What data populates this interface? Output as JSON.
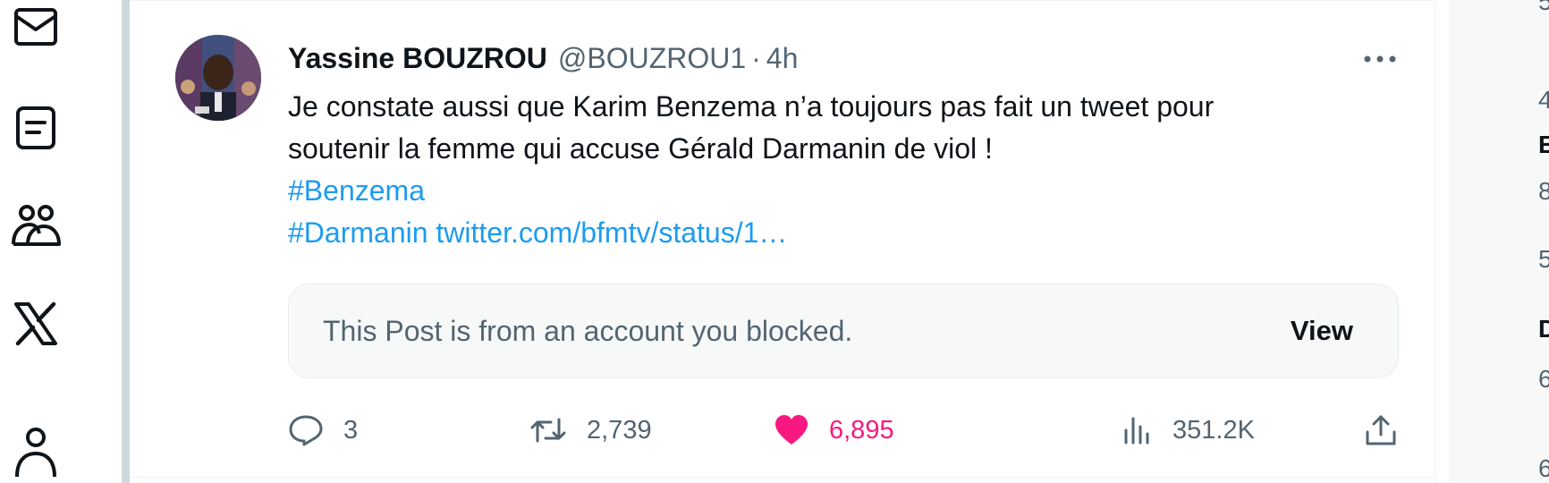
{
  "left_nav": {
    "icons": [
      "envelope-icon",
      "lists-icon",
      "communities-icon",
      "x-logo-icon",
      "profile-icon"
    ]
  },
  "tweet": {
    "display_name": "Yassine BOUZROU",
    "handle": "@BOUZROU1",
    "separator": "·",
    "time": "4h",
    "text_line1": "Je constate aussi que Karim Benzema n’a toujours pas fait un tweet pour",
    "text_line2": "soutenir la femme qui accuse Gérald Darmanin de viol !",
    "hashtag1": "#Benzema",
    "hashtag2": "#Darmanin",
    "link": "twitter.com/bfmtv/status/1…",
    "quote": {
      "message": "This Post is from an account you blocked.",
      "view_label": "View"
    },
    "actions": {
      "replies": "3",
      "reposts": "2,739",
      "likes": "6,895",
      "views": "351.2K"
    },
    "colors": {
      "link": "#1d9bf0",
      "like_active": "#f91880",
      "muted": "#536471"
    }
  },
  "right_sidebar": {
    "fragments": [
      "5",
      "4",
      "E",
      "8",
      "5",
      "D",
      "6",
      "6"
    ]
  }
}
